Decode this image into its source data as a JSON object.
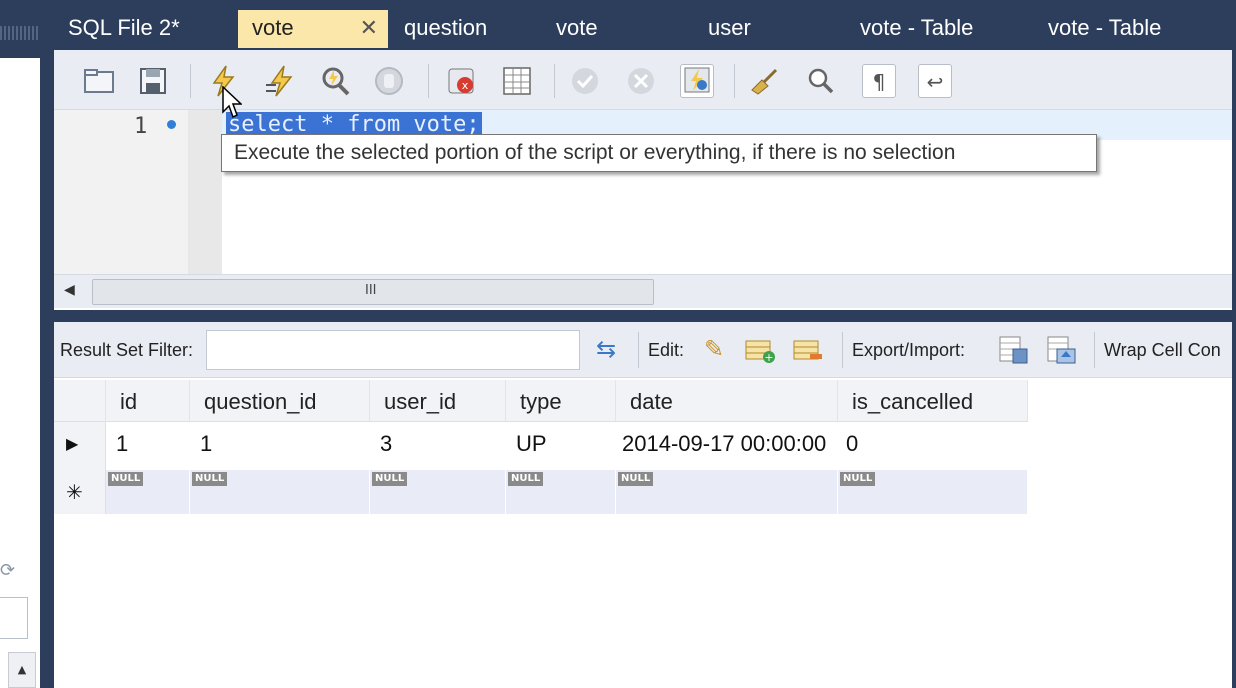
{
  "tabs": [
    {
      "label": "SQL File 2*",
      "active": false
    },
    {
      "label": "vote",
      "active": true,
      "close": "✕"
    },
    {
      "label": "question",
      "active": false
    },
    {
      "label": "vote",
      "active": false
    },
    {
      "label": "user",
      "active": false
    },
    {
      "label": "vote - Table",
      "active": false
    },
    {
      "label": "vote - Table",
      "active": false
    }
  ],
  "editor": {
    "line_number": "1",
    "code": "select * from vote;",
    "tooltip": "Execute the selected portion of the script or everything, if there is no selection",
    "scroll_grip": "III",
    "scroll_left_arrow": "◀"
  },
  "toolbar_icons": [
    "folder-icon",
    "save-icon",
    "execute-lightning-icon",
    "execute-current-lightning-icon",
    "explain-magnifier-icon",
    "stop-hand-icon",
    "toggle-error-stop-icon",
    "toggle-output-icon",
    "commit-check-icon",
    "rollback-x-icon",
    "autocommit-icon",
    "beautify-broom-icon",
    "find-icon",
    "invisible-chars-icon",
    "word-wrap-icon"
  ],
  "result": {
    "filter_label": "Result Set Filter:",
    "filter_value": "",
    "edit_label": "Edit:",
    "export_label": "Export/Import:",
    "wrap_label": "Wrap Cell Con"
  },
  "grid": {
    "columns": [
      "id",
      "question_id",
      "user_id",
      "type",
      "date",
      "is_cancelled"
    ],
    "rows": [
      [
        "1",
        "1",
        "3",
        "UP",
        "2014-09-17 00:00:00",
        "0"
      ]
    ],
    "null_label": "NULL",
    "current_row_marker": "▶",
    "new_row_marker": "✳"
  },
  "left_panel": {
    "scroll_up": "▲"
  },
  "colors": {
    "chrome": "#2c3e5b",
    "active_tab": "#fbe7a9",
    "selection": "#3b73d4",
    "null_row": "#e9ecf6"
  }
}
